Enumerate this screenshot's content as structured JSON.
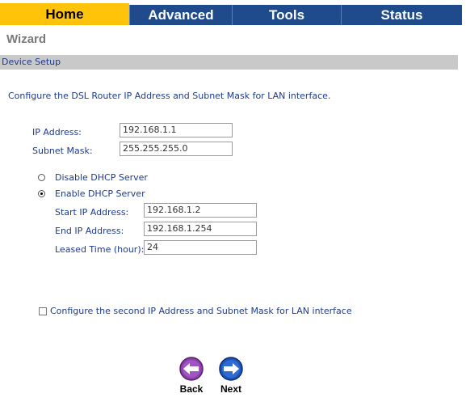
{
  "tabs": [
    {
      "label": "Home"
    },
    {
      "label": "Advanced"
    },
    {
      "label": "Tools"
    },
    {
      "label": "Status"
    }
  ],
  "page": {
    "title": "Wizard",
    "section": "Device Setup",
    "description": "Configure the DSL Router IP Address and Subnet Mask for LAN interface."
  },
  "lan": {
    "ip_label": "IP Address:",
    "ip_value": "192.168.1.1",
    "mask_label": "Subnet Mask:",
    "mask_value": "255.255.255.0"
  },
  "dhcp": {
    "disable_label": "Disable DHCP Server",
    "enable_label": "Enable DHCP Server",
    "selected": "enable",
    "start_label": "Start IP Address:",
    "start_value": "192.168.1.2",
    "end_label": "End IP Address:",
    "end_value": "192.168.1.254",
    "lease_label": "Leased Time (hour):",
    "lease_value": "24"
  },
  "second_ip": {
    "label": "Configure the second IP Address and Subnet Mask for LAN interface",
    "checked": false
  },
  "nav": {
    "back_label": "Back",
    "next_label": "Next",
    "back_color": "#8b3fa8",
    "next_color": "#1d54b8"
  },
  "colors": {
    "home_tab": "#ffc30a",
    "tab_bg": "#1f4a8c",
    "section_bar": "#c9c9c9",
    "text": "#1f3a8a"
  }
}
